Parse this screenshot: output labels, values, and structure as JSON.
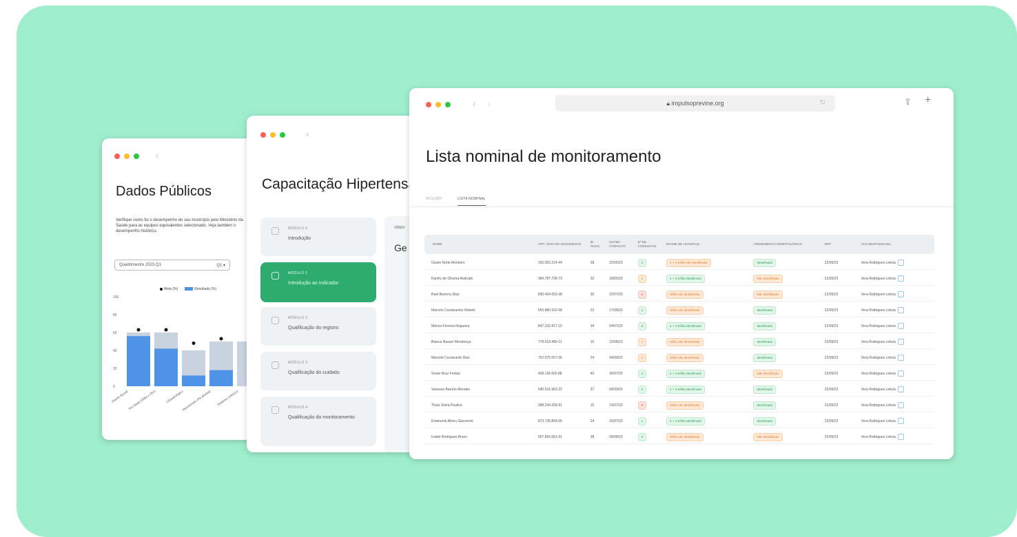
{
  "window_dados": {
    "title": "Dados Públicos",
    "description": "Verifique como foi o desempenho do seu município pelo Ministério da Saúde para as equipes equivalentes selecionado. Veja também o desempenho histórico.",
    "select_label": "Quadrimestre 2023.Q1",
    "select_value": "Q1 ▾",
    "legend": [
      "Meta (%)",
      "Resultado (%)"
    ]
  },
  "chart_data": {
    "type": "bar",
    "categories": [
      "Hipertensos (Saúde Bucal)",
      "Pré-Natal (Sífilis e HIV)",
      "Citopatológico",
      "Hipertensão (PA aferida)",
      "Diabetes (HbA1c)"
    ],
    "series": [
      {
        "name": "Resultado (%)",
        "values": [
          56,
          42,
          12,
          18,
          0
        ]
      },
      {
        "name": "Meta (%)",
        "values": [
          60,
          60,
          40,
          50,
          50
        ]
      }
    ],
    "targets": [
      60,
      60,
      45,
      50,
      50
    ],
    "ylim": [
      0,
      100
    ],
    "yticks": [
      "100",
      "80",
      "60",
      "40",
      "20",
      "0"
    ],
    "colors": {
      "resultado": "#4e93e6",
      "meta": "#c9d3e0"
    }
  },
  "window_capacitacao": {
    "title": "Capacitação Hipertensão",
    "panel_label": "VÍDEO",
    "panel_heading": "Ge",
    "modules": [
      {
        "label": "MÓDULO 0",
        "name": "Introdução",
        "active": false
      },
      {
        "label": "MÓDULO 1",
        "name": "Introdução ao Indicador",
        "active": true
      },
      {
        "label": "MÓDULO 2",
        "name": "Qualificação do registro",
        "active": false
      },
      {
        "label": "MÓDULO 3",
        "name": "Qualificação do cuidado",
        "active": false
      },
      {
        "label": "MÓDULO 4",
        "name": "Qualificação do monitoramento",
        "active": false
      }
    ]
  },
  "window_lista": {
    "url": "impulsoprevine.org",
    "title": "Lista nominal de monitoramento",
    "tabs": [
      "RESUMO",
      "LISTA NOMINAL"
    ],
    "columns": [
      "NOME",
      "CPF / DATA DE NASCIMENTO",
      "ID ATUAL",
      "ÚLTIMA CONSULTA",
      "Nº DE CONSULTAS",
      "EXAME DE HIV/SÍFILIS",
      "ATENDIMENTO ODONTOLÓGICO",
      "DPP",
      "ACS RESPONSÁVEL"
    ],
    "rows": [
      [
        "Gisele Norte Monteiro",
        "195.063.214-44",
        "28",
        "22/06/23",
        "2",
        "4 + 3 Sífilis não identificado",
        "Identificado",
        "22/09/23",
        "Vera Rodrigues Leticia"
      ],
      [
        "Kamily de Oliveira Andrade",
        "384.787.739-73",
        "32",
        "18/05/23",
        "1",
        "4 + 3 Sífilis identificado",
        "Não identificado",
        "22/09/23",
        "Vera Rodrigues Leticia"
      ],
      [
        "Ruel Bezerra Dias",
        "830.434.053-38",
        "30",
        "22/07/23",
        "0",
        "Sífilis não identificado",
        "Não identificado",
        "22/09/23",
        "Vera Rodrigues Leticia"
      ],
      [
        "Marcelo Cavalcantes Rebelo",
        "555.880.916-58",
        "22",
        "17/08/23",
        "2",
        "Sífilis não identificado",
        "Identificado",
        "22/09/23",
        "Vera Rodrigues Leticia"
      ],
      [
        "Márcia Ferreira Nogueira",
        "847.232.817-15",
        "34",
        "04/07/23",
        "3",
        "4 + 3 Sífilis identificado",
        "Identificado",
        "22/09/23",
        "Vera Rodrigues Leticia"
      ],
      [
        "Bianca Nasser Mendonça",
        "778.618.480-11",
        "15",
        "22/08/23",
        "1",
        "Sífilis não identificado",
        "Identificado",
        "22/09/23",
        "Vera Rodrigues Leticia"
      ],
      [
        "Marcelo Cavalcante Dias",
        "752.675.557-06",
        "24",
        "04/09/23",
        "1",
        "Sífilis não identificado",
        "Identificado",
        "22/09/23",
        "Vera Rodrigues Leticia"
      ],
      [
        "Vivian Braz Freitas",
        "438.118.425-88",
        "40",
        "30/07/23",
        "2",
        "4 + 3 Sífilis identificado",
        "Não identificado",
        "22/09/23",
        "Vera Rodrigues Leticia"
      ],
      [
        "Vanessa Barreto Mendes",
        "640.616.963-22",
        "37",
        "04/09/23",
        "3",
        "4 + 3 Sífilis identificado",
        "Identificado",
        "22/09/23",
        "Vera Rodrigues Leticia"
      ],
      [
        "Thaís Vieira Paulino",
        "288.234.209-91",
        "15",
        "19/07/23",
        "0",
        "Sífilis não identificado",
        "Identificado",
        "22/09/23",
        "Vera Rodrigues Leticia"
      ],
      [
        "Emanuele Abreu Giacomini",
        "873.730.864-06",
        "24",
        "15/07/23",
        "1",
        "4 + 3 Sífilis identificado",
        "Identificado",
        "22/09/23",
        "Vera Rodrigues Leticia"
      ],
      [
        "Isabel Rodrigues Bravo",
        "657.683.061-51",
        "38",
        "09/08/23",
        "3",
        "Sífilis não identificado",
        "Não identificado",
        "22/09/23",
        "Vera Rodrigues Leticia"
      ]
    ],
    "consult_status": [
      "green",
      "orange",
      "red",
      "green",
      "green",
      "orange",
      "orange",
      "green",
      "green",
      "red",
      "green",
      "green"
    ],
    "exam_status": [
      "orange",
      "green",
      "orange",
      "orange",
      "green",
      "orange",
      "orange",
      "green",
      "green",
      "orange",
      "green",
      "orange"
    ],
    "odonto_status": [
      "green",
      "orange",
      "orange",
      "green",
      "green",
      "green",
      "green",
      "orange",
      "green",
      "green",
      "green",
      "orange"
    ]
  }
}
